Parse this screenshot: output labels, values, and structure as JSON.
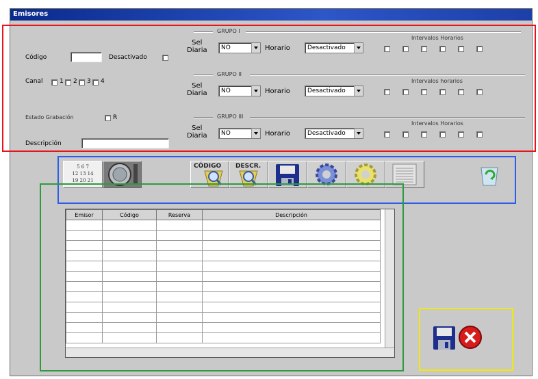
{
  "window": {
    "title": "Emisores"
  },
  "form": {
    "codigo_label": "Código",
    "codigo_value": "",
    "desactivado_label": "Desactivado",
    "canal_label": "Canal",
    "canal_options": [
      "1",
      "2",
      "3",
      "4"
    ],
    "estado_label": "Estado Grabación",
    "estado_option": "R",
    "descripcion_label": "Descripción",
    "descripcion_value": ""
  },
  "groups": [
    {
      "title": "GRUPO I",
      "sel_label": "Sel\nDiaria",
      "sel_value": "NO",
      "horario_label": "Horario",
      "horario_value": "Desactivado",
      "intervals_label": "Intervalos Horarios"
    },
    {
      "title": "GRUPO II",
      "sel_label": "Sel\nDiaria",
      "sel_value": "NO",
      "horario_label": "Horario",
      "horario_value": "Desactivado",
      "intervals_label": "Intervalos horarios"
    },
    {
      "title": "GRUPO III",
      "sel_label": "Sel\nDiaria",
      "sel_value": "NO",
      "horario_label": "Horario",
      "horario_value": "Desactivado",
      "intervals_label": "Intervalos Horarios"
    }
  ],
  "toolbar": {
    "calendar_text": "5 6 7\n12 13 14\n19 20 21",
    "codigo_label": "CÓDIGO",
    "desc_label": "DESCR."
  },
  "table": {
    "columns": [
      "Emisor",
      "Código",
      "Reserva",
      "Descripción"
    ],
    "rows": 12
  },
  "colors": {
    "highlight_red": "#e8141b",
    "highlight_blue": "#2f5de8",
    "highlight_green": "#2e9a3f",
    "highlight_yellow": "#f2ea00"
  },
  "icons": [
    "calendar-icon",
    "clock-icon",
    "search-code-icon",
    "search-desc-icon",
    "save-icon",
    "gear-blue-icon",
    "gear-yellow-icon",
    "list-icon",
    "recycle-bin-icon",
    "close-icon"
  ]
}
